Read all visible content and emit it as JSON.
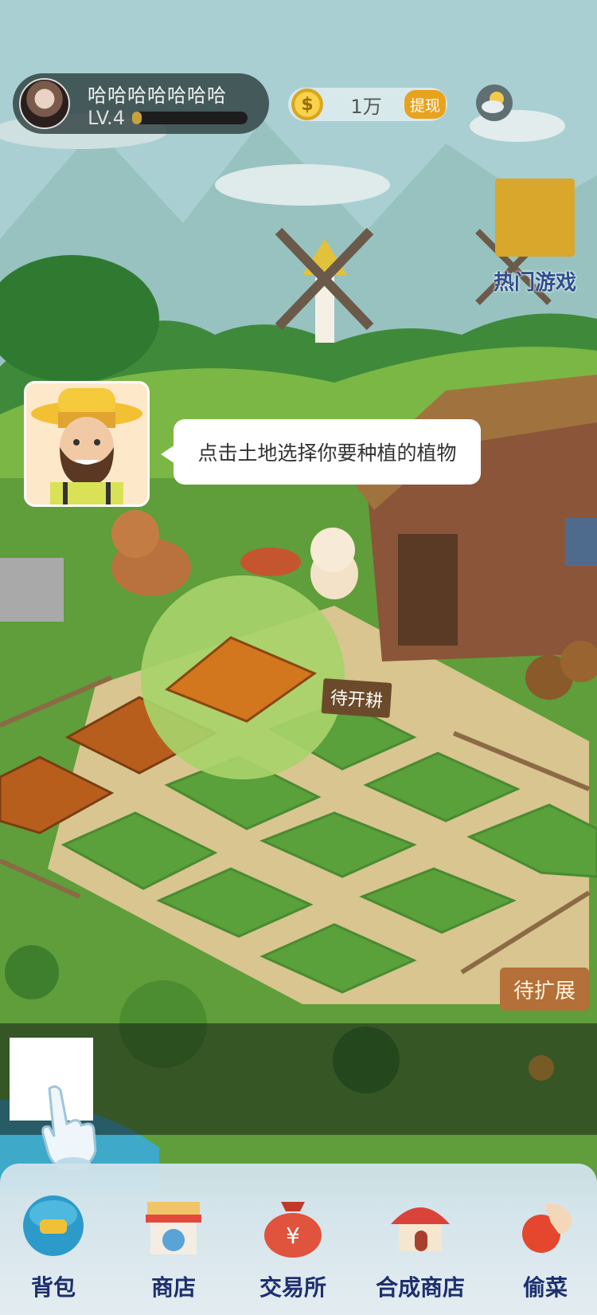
{
  "player": {
    "name": "哈哈哈哈哈哈哈",
    "level": "LV.4",
    "xp_progress": 0.06
  },
  "currency": {
    "coins": "1万",
    "withdraw_label": "提现"
  },
  "side": {
    "hot_games_label": "热门游戏"
  },
  "guide": {
    "message": "点击土地选择你要种植的植物"
  },
  "farm": {
    "till_sign": "待开耕",
    "expand_sign": "待扩展"
  },
  "nav": {
    "items": [
      {
        "label": "背包",
        "icon": "backpack-icon"
      },
      {
        "label": "商店",
        "icon": "shop-icon"
      },
      {
        "label": "交易所",
        "icon": "money-bag-icon"
      },
      {
        "label": "合成商店",
        "icon": "house-icon"
      },
      {
        "label": "偷菜",
        "icon": "steal-hand-icon"
      }
    ]
  },
  "colors": {
    "accent": "#e9a21d",
    "nav_text": "#1d2f6f",
    "hot_games_text": "#2e4f8f"
  }
}
